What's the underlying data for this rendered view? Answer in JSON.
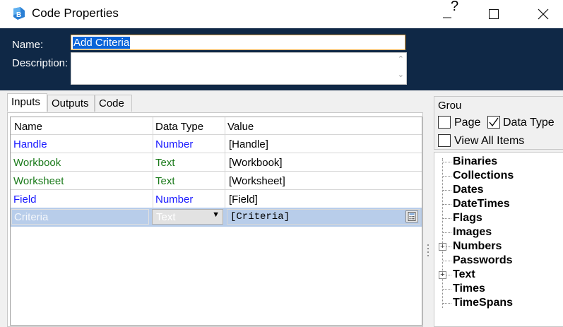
{
  "window": {
    "title": "Code Properties",
    "help_glyph": "?",
    "minimize_glyph": "—",
    "maximize_glyph": "□",
    "close_glyph": "✕"
  },
  "header": {
    "name_label": "Name:",
    "name_value": "Add Criteria",
    "description_label": "Description:",
    "description_value": ""
  },
  "tabs": [
    {
      "label": "Inputs",
      "active": true
    },
    {
      "label": "Outputs",
      "active": false
    },
    {
      "label": "Code",
      "active": false
    }
  ],
  "grid": {
    "columns": [
      "Name",
      "Data Type",
      "Value"
    ],
    "rows": [
      {
        "name": "Handle",
        "type": "Number",
        "value": "[Handle]",
        "color": "#1a1aff"
      },
      {
        "name": "Workbook",
        "type": "Text",
        "value": "[Workbook]",
        "color": "#1a7a1a"
      },
      {
        "name": "Worksheet",
        "type": "Text",
        "value": "[Worksheet]",
        "color": "#1a7a1a"
      },
      {
        "name": "Field",
        "type": "Number",
        "value": "[Field]",
        "color": "#1a1aff"
      }
    ],
    "selected_row": {
      "name": "Criteria",
      "type": "Text",
      "value": "[Criteria]"
    }
  },
  "group_panel": {
    "title": "Grou",
    "page_label": "Page",
    "page_checked": false,
    "datatype_label": "Data Type",
    "datatype_checked": true,
    "view_all_label": "View All Items",
    "view_all_checked": false
  },
  "tree": {
    "items": [
      "Binaries",
      "Collections",
      "Dates",
      "DateTimes",
      "Flags",
      "Images",
      "Numbers",
      "Passwords",
      "Text",
      "Times",
      "TimeSpans"
    ],
    "expandable": [
      "Numbers",
      "Text"
    ]
  }
}
